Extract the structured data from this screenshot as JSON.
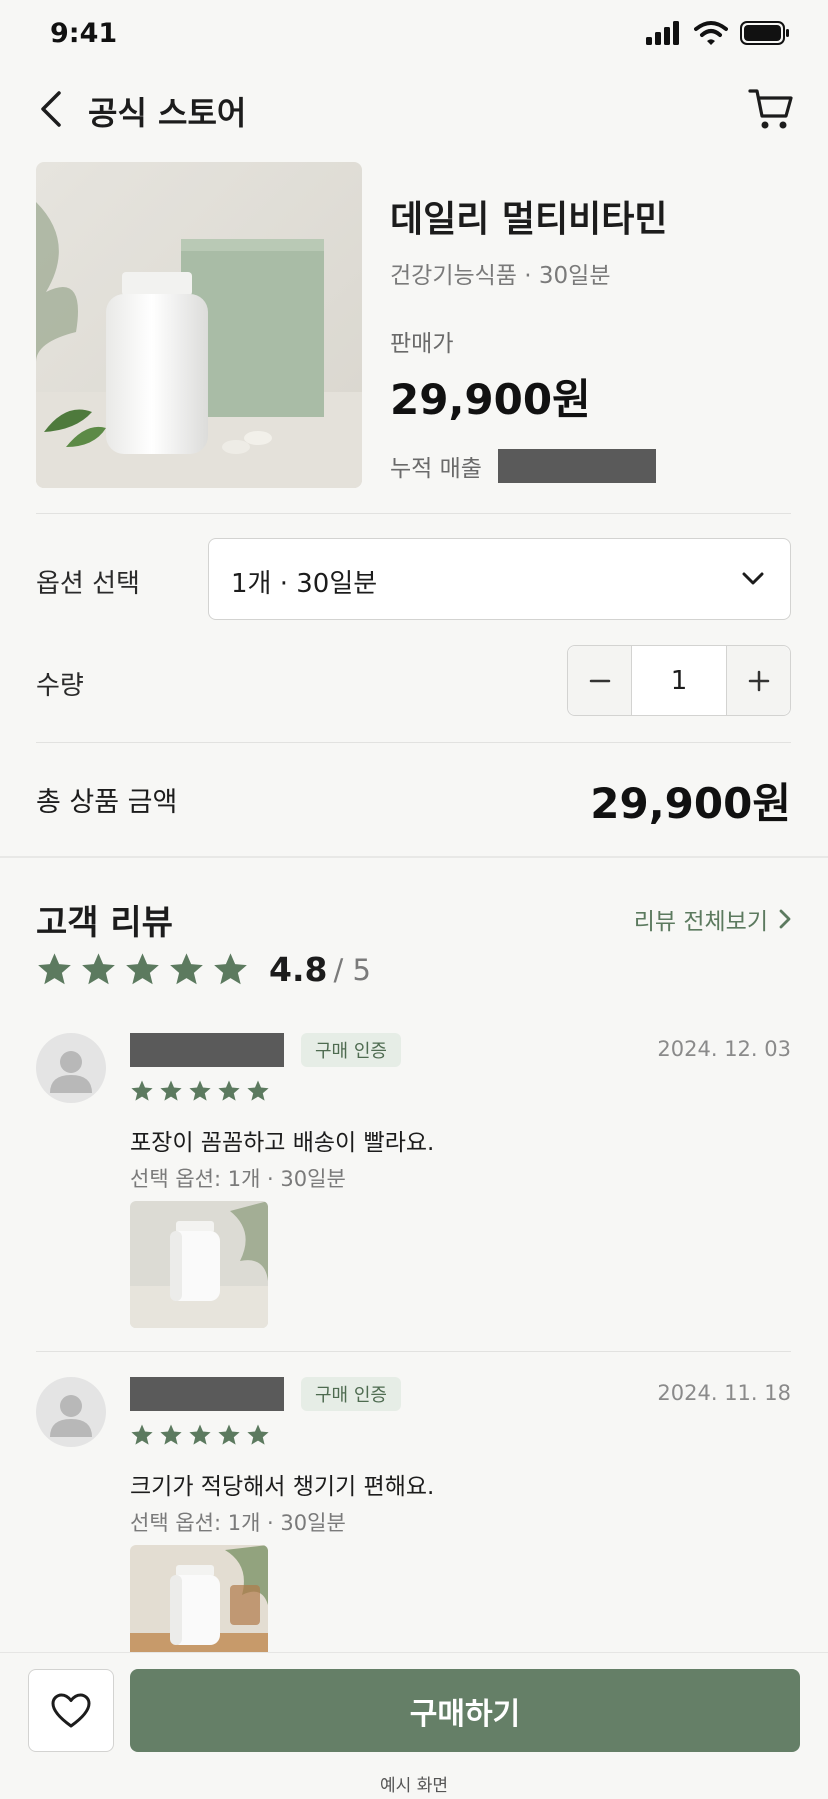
{
  "status_bar": {
    "time": "9:41"
  },
  "nav": {
    "title": "공식 스토어"
  },
  "product": {
    "name": "데일리 멀티비타민",
    "subtitle": "건강기능식품 · 30일분",
    "price_label": "판매가",
    "price": "29,900원",
    "sales_label": "누적 매출"
  },
  "options": {
    "label": "옵션 선택",
    "selected": "1개 · 30일분",
    "quantity_label": "수량",
    "quantity": "1"
  },
  "total": {
    "label": "총 상품 금액",
    "price": "29,900원"
  },
  "reviews": {
    "title": "고객 리뷰",
    "view_all": "리뷰 전체보기",
    "rating": "4.8",
    "rating_max": "/ 5",
    "items": [
      {
        "badge": "구매 인증",
        "date": "2024. 12. 03",
        "rating": 5,
        "text": "포장이 꼼꼼하고 배송이 빨라요.",
        "option": "선택 옵션: 1개 · 30일분"
      },
      {
        "badge": "구매 인증",
        "date": "2024. 11. 18",
        "rating": 5,
        "text": "크기가 적당해서 챙기기 편해요.",
        "option": "선택 옵션: 1개 · 30일분"
      }
    ]
  },
  "bottom": {
    "buy_label": "구매하기",
    "caption": "예시 화면"
  },
  "colors": {
    "accent": "#657f67",
    "star": "#5c7a5f",
    "redaction": "#5a5a5a"
  }
}
